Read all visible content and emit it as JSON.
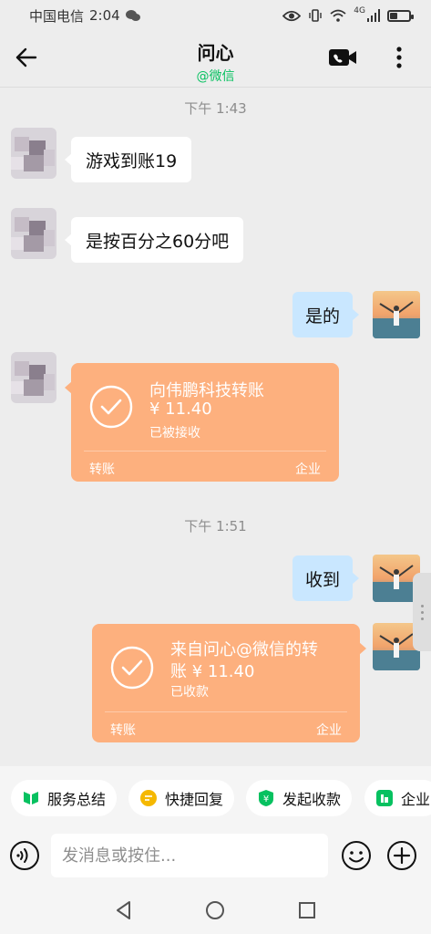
{
  "status_bar": {
    "carrier": "中国电信",
    "time": "2:04",
    "signal_label": "4G"
  },
  "header": {
    "title": "问心",
    "subtitle": "@微信",
    "back_icon": "back-arrow-icon",
    "video_icon": "video-call-icon",
    "more_icon": "more-vertical-icon",
    "subtitle_color": "#07c160"
  },
  "messages": {
    "timestamp_1": "下午 1:43",
    "msg_1": "游戏到账19",
    "msg_2": "是按百分之60分吧",
    "msg_3": "是的",
    "transfer_1": {
      "title": "向伟鹏科技转账",
      "amount": "¥ 11.40",
      "status": "已被接收",
      "footer_left": "转账",
      "footer_right": "企业"
    },
    "timestamp_2": "下午 1:51",
    "msg_4": "收到",
    "transfer_2": {
      "title_line1": "来自问心@微信的转",
      "title_line2": "账 ¥ 11.40",
      "status": "已收款",
      "footer_left": "转账",
      "footer_right": "企业"
    }
  },
  "quick_actions": [
    {
      "label": "服务总结",
      "icon": "service-summary-icon"
    },
    {
      "label": "快捷回复",
      "icon": "quick-reply-icon"
    },
    {
      "label": "发起收款",
      "icon": "collect-payment-icon"
    },
    {
      "label": "企业",
      "icon": "enterprise-icon"
    }
  ],
  "input": {
    "placeholder": "发消息或按住..."
  },
  "colors": {
    "transfer_bg": "#fdb07e",
    "outgoing_bubble": "#c9e7ff",
    "accent_green": "#07c160",
    "quick_reply_yellow": "#f5b800"
  }
}
